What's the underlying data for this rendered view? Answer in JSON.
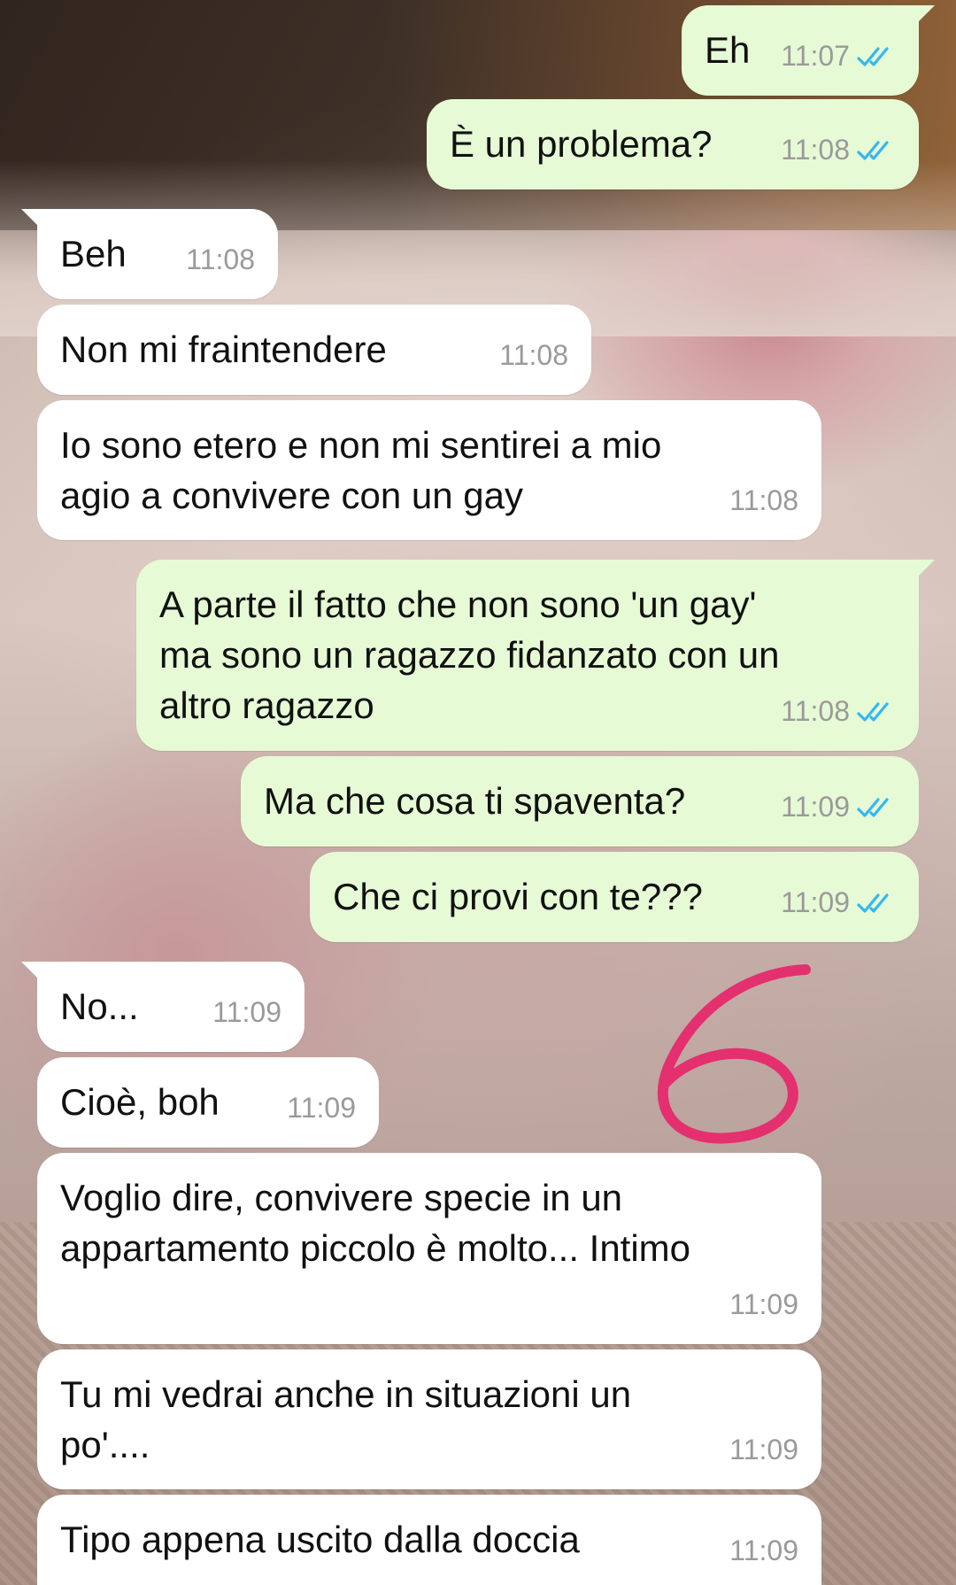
{
  "theme": {
    "outgoing_bubble": "#e6fad5",
    "incoming_bubble": "#ffffff",
    "read_tick_color": "#34b7f1",
    "annotation_color": "#e4306e"
  },
  "messages": [
    {
      "direction": "out",
      "text": "Eh",
      "time": "11:07",
      "read": true
    },
    {
      "direction": "out",
      "text": "È un problema?",
      "time": "11:08",
      "read": true
    },
    {
      "direction": "in",
      "text": "Beh",
      "time": "11:08"
    },
    {
      "direction": "in",
      "text": "Non mi fraintendere",
      "time": "11:08"
    },
    {
      "direction": "in",
      "text": "Io sono etero e non mi sentirei a mio\nagio a convivere con un gay",
      "time": "11:08"
    },
    {
      "direction": "out",
      "text": "A parte il fatto che non sono 'un gay'\nma sono un ragazzo fidanzato con un\naltro ragazzo",
      "time": "11:08",
      "read": true
    },
    {
      "direction": "out",
      "text": "Ma che cosa ti spaventa?",
      "time": "11:09",
      "read": true
    },
    {
      "direction": "out",
      "text": "Che ci provi con te???",
      "time": "11:09",
      "read": true
    },
    {
      "direction": "in",
      "text": "No...",
      "time": "11:09"
    },
    {
      "direction": "in",
      "text": "Cioè, boh",
      "time": "11:09"
    },
    {
      "direction": "in",
      "text": "Voglio dire, convivere specie in un\nappartamento piccolo è molto... Intimo",
      "time": "11:09"
    },
    {
      "direction": "in",
      "text": "Tu mi vedrai anche in situazioni un\npo'....",
      "time": "11:09"
    },
    {
      "direction": "in",
      "text": "Tipo appena uscito dalla doccia",
      "time": "11:09"
    }
  ],
  "annotation": {
    "text": "6"
  }
}
